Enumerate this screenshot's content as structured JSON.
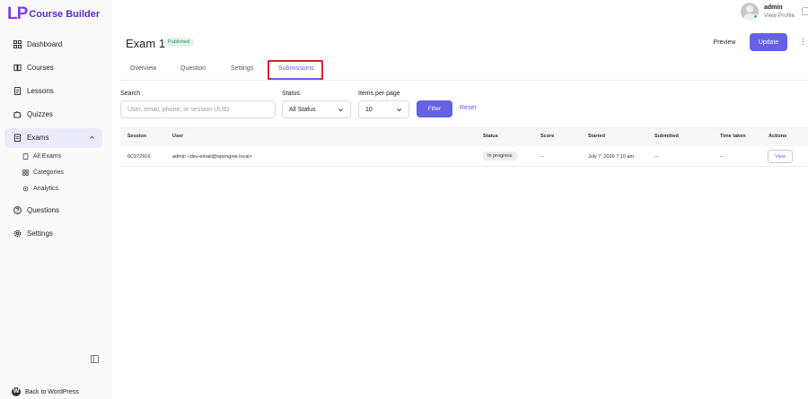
{
  "brand": {
    "mark": "LP",
    "name": "Course Builder"
  },
  "sidebar": {
    "items": [
      {
        "label": "Dashboard",
        "icon": "grid-icon"
      },
      {
        "label": "Courses",
        "icon": "book-icon"
      },
      {
        "label": "Lessons",
        "icon": "document-icon"
      },
      {
        "label": "Quizzes",
        "icon": "puzzle-icon"
      },
      {
        "label": "Exams",
        "icon": "clipboard-icon",
        "active": true
      },
      {
        "label": "Questions",
        "icon": "question-circle-icon"
      },
      {
        "label": "Settings",
        "icon": "gear-icon"
      }
    ],
    "exams_sub": [
      {
        "label": "All Exams",
        "icon": "document-icon"
      },
      {
        "label": "Categories",
        "icon": "grid-icon"
      },
      {
        "label": "Analytics",
        "icon": "settings-icon"
      }
    ],
    "back_label": "Back to WordPress"
  },
  "user": {
    "name": "admin",
    "link": "View Profile"
  },
  "header": {
    "title": "Exam 1",
    "status": "Published",
    "preview_label": "Preview",
    "update_label": "Update",
    "more": "⋮"
  },
  "tabs": [
    "Overview",
    "Question",
    "Settings",
    "Submissions"
  ],
  "active_tab": "Submissions",
  "filters": {
    "search_label": "Search",
    "search_placeholder": "User, email, phone, or session UUID",
    "status_label": "Status",
    "status_value": "All Status",
    "per_page_label": "Items per page",
    "per_page_value": "10",
    "filter_label": "Filter",
    "reset_label": "Reset"
  },
  "table": {
    "headers": [
      "Session",
      "User",
      "Status",
      "Score",
      "Started",
      "Submitted",
      "Time taken",
      "Actions"
    ],
    "rows": [
      {
        "session": "6C972916",
        "user": "admin <dev-email@wpengine.local>",
        "status": "In progress",
        "score": "--",
        "started": "July 7, 2026 7:10 am",
        "submitted": "--",
        "time_taken": "--",
        "action": "View"
      }
    ]
  },
  "colors": {
    "accent": "#6462e3",
    "highlight": "#d6262b",
    "published": "#2a8a4a"
  }
}
